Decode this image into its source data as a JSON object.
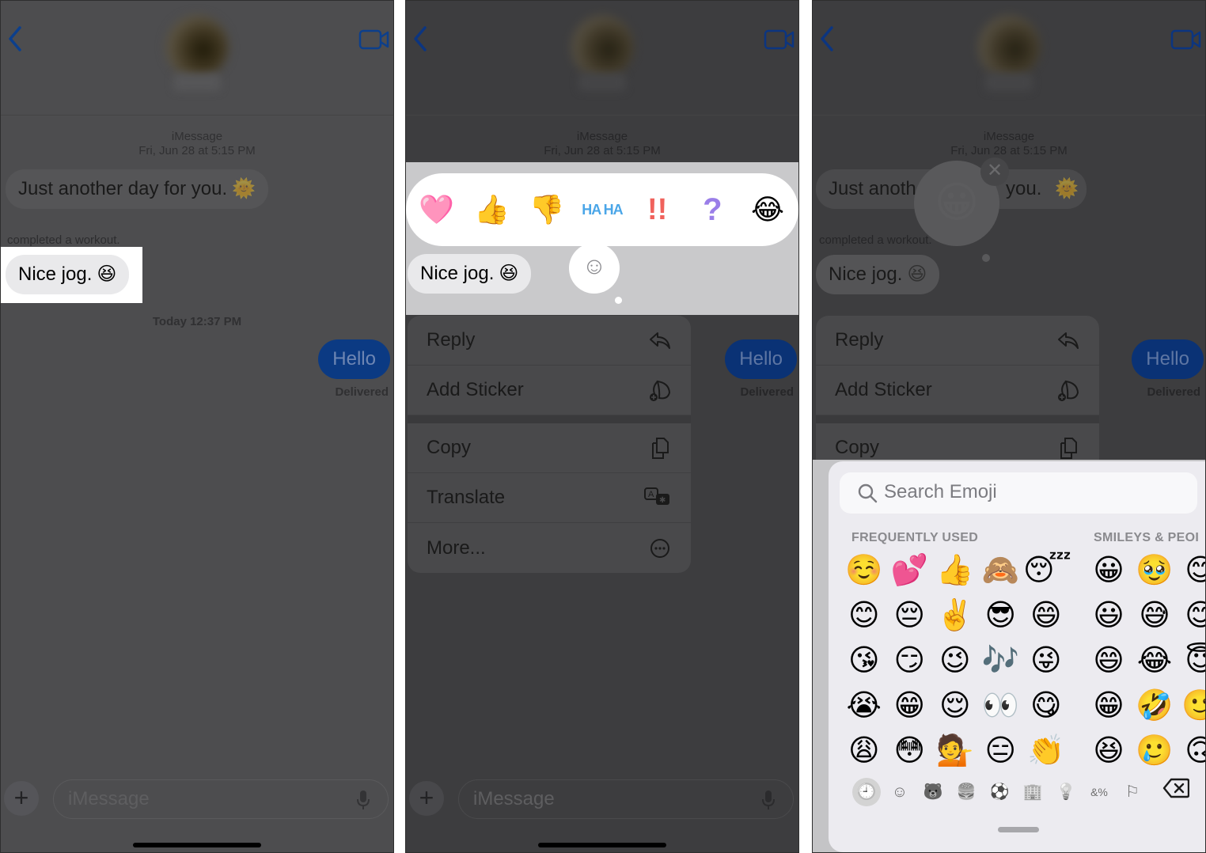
{
  "header": {
    "back_label": "Back",
    "video_label": "FaceTime video"
  },
  "thread": {
    "service": "iMessage",
    "first_timestamp": "Fri, Jun 28 at 5:15 PM",
    "message_1": {
      "text": "Just another day for you.",
      "emoji": "🌞"
    },
    "workout_note": "completed a workout.",
    "message_2": {
      "text": "Nice jog.",
      "emoji": "😆"
    },
    "second_timestamp": "Today 12:37 PM",
    "outgoing": {
      "text": "Hello",
      "status": "Delivered"
    },
    "message_1_partial_left": "Just anoth",
    "message_1_partial_right": "you."
  },
  "composer": {
    "placeholder": "iMessage",
    "plus_label": "+"
  },
  "tapbacks": [
    {
      "name": "heart",
      "glyph": "🩷"
    },
    {
      "name": "thumbs-up",
      "glyph": "👍"
    },
    {
      "name": "thumbs-down",
      "glyph": "👎"
    },
    {
      "name": "haha",
      "glyph": "HA HA"
    },
    {
      "name": "exclamation",
      "glyph": "!!"
    },
    {
      "name": "question",
      "glyph": "?"
    },
    {
      "name": "laughing",
      "glyph": "😂"
    }
  ],
  "add_emoji_glyph": "☺",
  "context_menu": {
    "items": [
      {
        "label": "Reply",
        "icon": "reply-icon"
      },
      {
        "label": "Add Sticker",
        "icon": "add-sticker-icon"
      },
      {
        "label": "Copy",
        "icon": "copy-icon"
      },
      {
        "label": "Translate",
        "icon": "translate-icon"
      },
      {
        "label": "More...",
        "icon": "more-icon"
      }
    ]
  },
  "sticker_preview": {
    "glyph": "😀",
    "close_glyph": "✕"
  },
  "emoji_keyboard": {
    "search_placeholder": "Search Emoji",
    "sections": [
      {
        "title": "FREQUENTLY USED",
        "emojis": [
          "☺️",
          "💕",
          "👍",
          "🙈",
          "😴",
          "😊",
          "😔",
          "✌️",
          "😎",
          "😄",
          "😘",
          "😏",
          "😉",
          "🎶",
          "😜",
          "😭",
          "😁",
          "😌",
          "👀",
          "😋",
          "😩",
          "😳",
          "💁",
          "😑",
          "👏"
        ]
      },
      {
        "title": "SMILEYS & PEOPLE",
        "title_visible": "SMILEYS & PEOI",
        "emojis": [
          "😀",
          "🥹",
          "😊",
          "😃",
          "😅",
          "😊",
          "😄",
          "😂",
          "😇",
          "😁",
          "🤣",
          "🙂",
          "😆",
          "🥲",
          "🙃"
        ]
      }
    ],
    "categories": [
      {
        "name": "recent",
        "glyph": "🕘",
        "active": true
      },
      {
        "name": "smileys",
        "glyph": "☺"
      },
      {
        "name": "animals",
        "glyph": "🐻"
      },
      {
        "name": "food",
        "glyph": "🍔"
      },
      {
        "name": "activity",
        "glyph": "⚽"
      },
      {
        "name": "travel",
        "glyph": "🏢"
      },
      {
        "name": "objects",
        "glyph": "💡"
      },
      {
        "name": "symbols",
        "glyph": "&%"
      },
      {
        "name": "flags",
        "glyph": "⚐"
      }
    ]
  },
  "colors": {
    "accent": "#0a5cd8",
    "outgoing_bubble": "#0b3a83",
    "incoming_bubble": "#e9e9eb",
    "dim_overlay": "#4d4d4f",
    "keyboard_bg": "#ecebf0"
  }
}
